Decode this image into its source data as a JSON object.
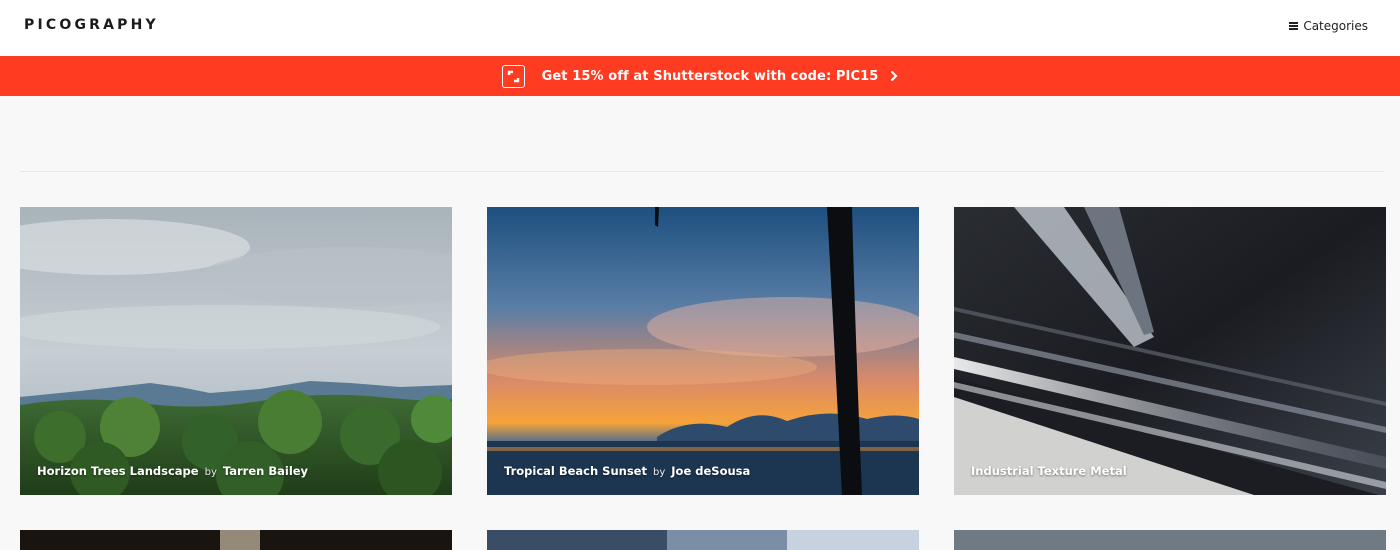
{
  "header": {
    "logo": "PICOGRAPHY",
    "categories_label": "Categories"
  },
  "promo": {
    "text": "Get 15% off at Shutterstock with code: PIC15"
  },
  "photos": [
    {
      "title": "Horizon Trees Landscape",
      "by": "by",
      "author": "Tarren Bailey"
    },
    {
      "title": "Tropical Beach Sunset",
      "by": "by",
      "author": "Joe deSousa"
    },
    {
      "title": "Industrial Texture Metal",
      "by": "",
      "author": ""
    }
  ],
  "colors": {
    "promo_bg": "#ff3b22",
    "page_bg": "#f8f8f8"
  },
  "icons": {
    "menu": "hamburger-icon",
    "shutterstock": "shutterstock-icon",
    "arrow": "chevron-right-icon"
  }
}
